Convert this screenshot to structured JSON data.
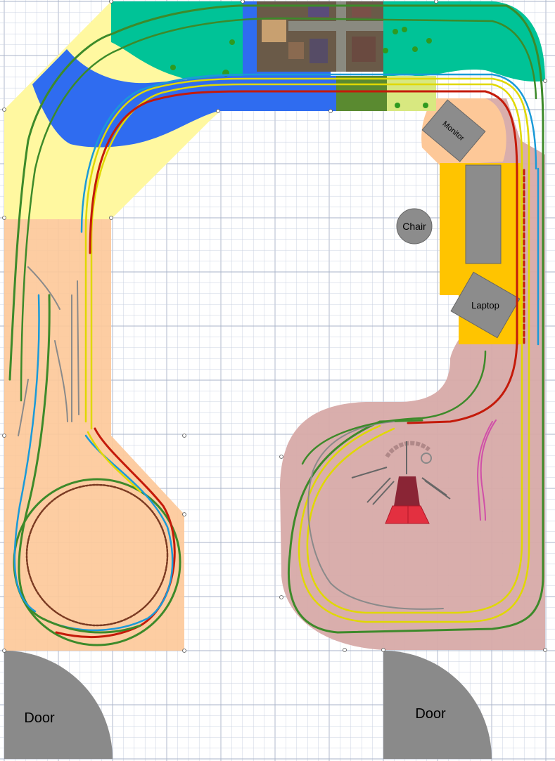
{
  "labels": {
    "monitor": "Monitor",
    "chair": "Chair",
    "laptop": "Laptop",
    "door_left": "Door",
    "door_right": "Door"
  },
  "colors": {
    "background": "#ffffff",
    "grid_minor": "#c9d0e0",
    "grid_major": "#a9b3c8",
    "peach_zone": "#fdc898",
    "mauve_zone": "#d7aaa8",
    "yellow_zone": "#fff8a0",
    "teal_zone": "#00c397",
    "water": "#2f6cf0",
    "desk": "#ffc400",
    "furniture": "#8c8c8c",
    "door": "#8a8a8a",
    "track_green": "#3d8a2a",
    "track_yellow": "#f4f000",
    "track_red": "#c41a0a",
    "track_blue": "#1a9ad8",
    "track_gray": "#8a8a8a",
    "track_brown": "#7a3a22",
    "track_pink": "#d050a8",
    "turntable_red": "#e33040",
    "turntable_dark": "#8a2535"
  }
}
